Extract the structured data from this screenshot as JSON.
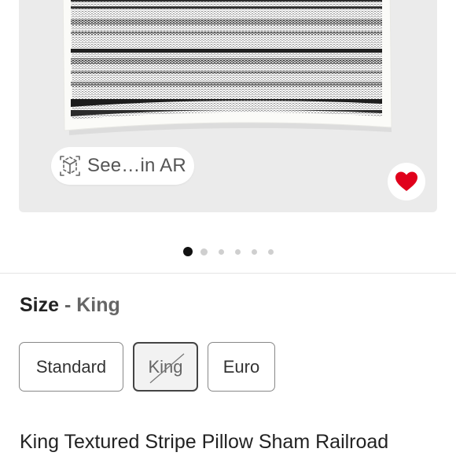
{
  "hero": {
    "ar_button_label": "See…in AR",
    "ar_icon": "ar-cube-icon",
    "favorite_icon": "heart-icon",
    "favorite_color": "#e0001b"
  },
  "carousel": {
    "total_dots": 6,
    "active_index": 0
  },
  "size_selector": {
    "label": "Size",
    "separator": " - ",
    "selected_value": "King",
    "options": [
      {
        "label": "Standard",
        "selected": false,
        "unavailable": false
      },
      {
        "label": "King",
        "selected": true,
        "unavailable": true
      },
      {
        "label": "Euro",
        "selected": false,
        "unavailable": false
      }
    ]
  },
  "product": {
    "title": "King Textured Stripe Pillow Sham Railroad"
  }
}
